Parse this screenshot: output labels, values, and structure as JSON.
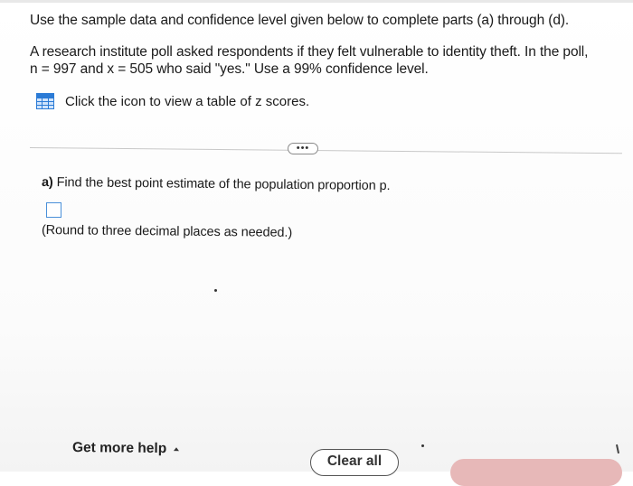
{
  "instructions": "Use the sample data and confidence level given below to complete parts (a) through (d).",
  "question": {
    "line1": "A research institute poll asked respondents if they felt vulnerable to identity theft. In the poll,",
    "line2": "n = 997 and x = 505 who said \"yes.\" Use a 99% confidence level."
  },
  "zscore_link": {
    "icon": "table-icon",
    "text": "Click the icon to view a table of z scores."
  },
  "more_button": "•••",
  "part_a": {
    "label": "a)",
    "prompt": "Find the best point estimate of the population proportion p.",
    "answer_value": "",
    "note": "(Round to three decimal places as needed.)"
  },
  "footer": {
    "help_label": "Get more help",
    "help_icon": "caret-up-icon",
    "clear_label": "Clear all"
  },
  "colors": {
    "accent": "#4a90d9",
    "icon_blue": "#2b7bd6",
    "check_button": "#e7b8b8"
  }
}
